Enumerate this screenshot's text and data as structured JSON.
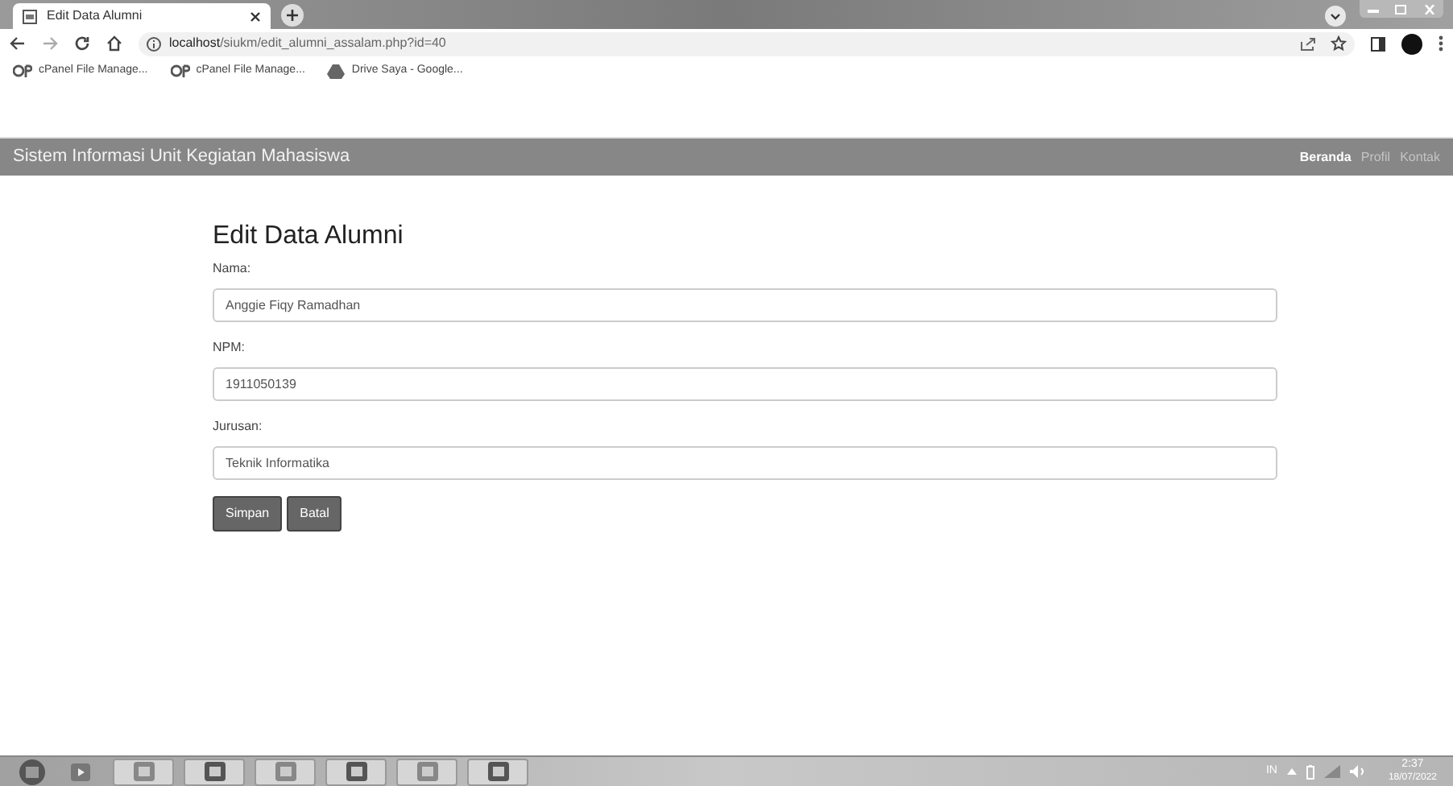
{
  "browser": {
    "tab_title": "Edit Data Alumni",
    "url_host": "localhost",
    "url_path": "/siukm/edit_alumni_assalam.php?id=40",
    "bookmarks": [
      {
        "label": "cPanel File Manage...",
        "kind": "cpanel"
      },
      {
        "label": "cPanel File Manage...",
        "kind": "cpanel"
      },
      {
        "label": "Drive Saya - Google...",
        "kind": "drive"
      }
    ]
  },
  "navbar": {
    "brand": "Sistem Informasi Unit Kegiatan Mahasiswa",
    "links": [
      {
        "label": "Beranda",
        "selected": true
      },
      {
        "label": "Profil",
        "selected": false
      },
      {
        "label": "Kontak",
        "selected": false
      }
    ]
  },
  "form": {
    "title": "Edit Data Alumni",
    "fields": [
      {
        "label": "Nama:",
        "value": "Anggie Fiqy Ramadhan"
      },
      {
        "label": "NPM:",
        "value": "1911050139"
      },
      {
        "label": "Jurusan:",
        "value": "Teknik Informatika"
      }
    ],
    "buttons": [
      "Simpan",
      "Batal"
    ]
  },
  "taskbar": {
    "tray_language": "IN",
    "time": "2:37",
    "date": "18/07/2022"
  }
}
